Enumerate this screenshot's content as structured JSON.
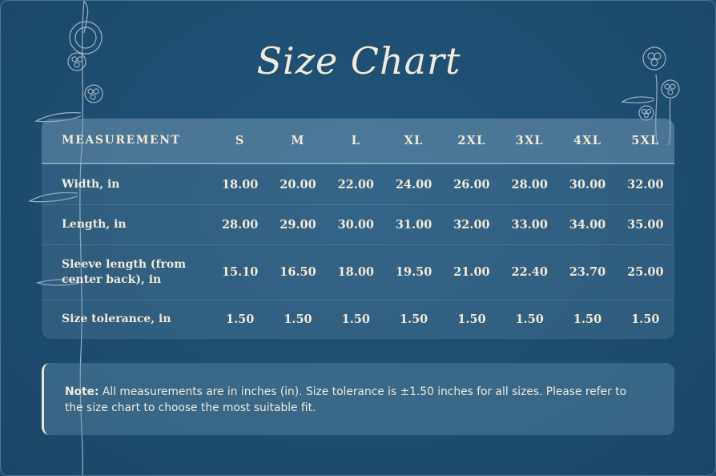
{
  "title": "Size Chart",
  "table": {
    "header_label": "MEASUREMENT",
    "sizes": [
      "S",
      "M",
      "L",
      "XL",
      "2XL",
      "3XL",
      "4XL",
      "5XL"
    ],
    "rows": [
      {
        "label": "Width, in",
        "values": [
          "18.00",
          "20.00",
          "22.00",
          "24.00",
          "26.00",
          "28.00",
          "30.00",
          "32.00"
        ]
      },
      {
        "label": "Length, in",
        "values": [
          "28.00",
          "29.00",
          "30.00",
          "31.00",
          "32.00",
          "33.00",
          "34.00",
          "35.00"
        ]
      },
      {
        "label_line1": "Sleeve length (from",
        "label_line2": "center back), in",
        "values": [
          "15.10",
          "16.50",
          "18.00",
          "19.50",
          "21.00",
          "22.40",
          "23.70",
          "25.00"
        ]
      },
      {
        "label": "Size tolerance, in",
        "values": [
          "1.50",
          "1.50",
          "1.50",
          "1.50",
          "1.50",
          "1.50",
          "1.50",
          "1.50"
        ]
      }
    ]
  },
  "note": {
    "prefix": "Note:",
    "text": " All measurements are in inches (in). Size tolerance is ±1.50 inches for all sizes. Please refer to the size chart to choose the most suitable fit."
  },
  "colors": {
    "background": "#1e4d70",
    "text": "#f1ead9"
  }
}
